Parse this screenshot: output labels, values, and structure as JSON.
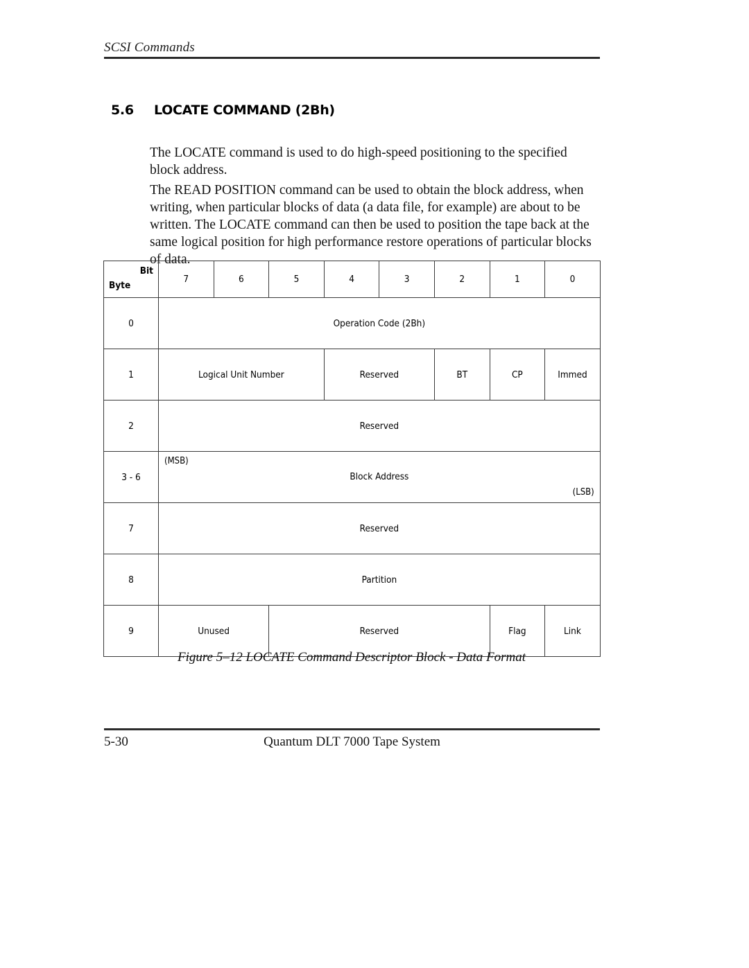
{
  "header": {
    "running_title": "SCSI Commands"
  },
  "section": {
    "number": "5.6",
    "title": "LOCATE COMMAND  (2Bh)"
  },
  "body": {
    "paragraph_1": "The LOCATE command is used to do high-speed positioning to the specified block address.",
    "paragraph_2": "The READ POSITION command can be used to obtain the block address, when writing, when particular blocks of data (a data file, for example) are about to be written. The LOCATE command can then be used to position the tape back at the same logical position for high performance restore operations of particular blocks of data."
  },
  "table": {
    "corner": {
      "bit_label": "Bit",
      "byte_label": "Byte"
    },
    "bit_headers": [
      "7",
      "6",
      "5",
      "4",
      "3",
      "2",
      "1",
      "0"
    ],
    "rows": [
      {
        "byte": "0",
        "cells": [
          {
            "text": "Operation Code (2Bh)",
            "span": 8
          }
        ]
      },
      {
        "byte": "1",
        "cells": [
          {
            "text": "Logical Unit Number",
            "span": 3
          },
          {
            "text": "Reserved",
            "span": 2
          },
          {
            "text": "BT",
            "span": 1
          },
          {
            "text": "CP",
            "span": 1
          },
          {
            "text": "Immed",
            "span": 1
          }
        ]
      },
      {
        "byte": "2",
        "cells": [
          {
            "text": "Reserved",
            "span": 8
          }
        ]
      },
      {
        "byte": "3 - 6",
        "msb": "(MSB)",
        "lsb": "(LSB)",
        "cells": [
          {
            "text": "Block Address",
            "span": 8
          }
        ]
      },
      {
        "byte": "7",
        "cells": [
          {
            "text": "Reserved",
            "span": 8
          }
        ]
      },
      {
        "byte": "8",
        "cells": [
          {
            "text": "Partition",
            "span": 8
          }
        ]
      },
      {
        "byte": "9",
        "cells": [
          {
            "text": "Unused",
            "span": 2
          },
          {
            "text": "Reserved",
            "span": 4
          },
          {
            "text": "Flag",
            "span": 1
          },
          {
            "text": "Link",
            "span": 1
          }
        ]
      }
    ]
  },
  "figure": {
    "caption": "Figure 5–12  LOCATE Command Descriptor Block - Data Format"
  },
  "footer": {
    "page_number": "5-30",
    "book_title": "Quantum DLT 7000 Tape System"
  },
  "colors": {
    "text": "#000000",
    "rule": "#2b2b2b",
    "table_border": "#3a3a3a",
    "background": "#ffffff"
  }
}
